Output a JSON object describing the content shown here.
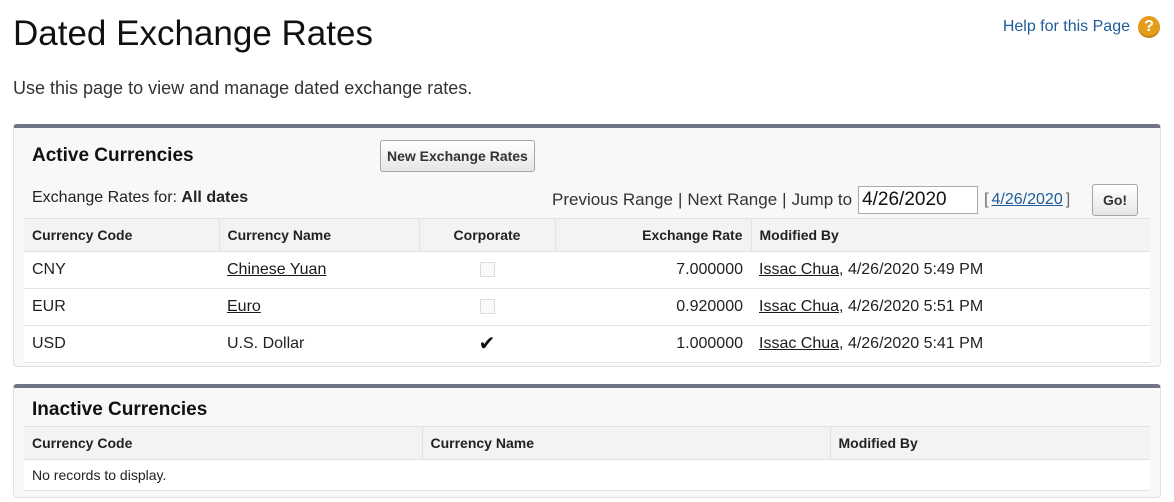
{
  "page": {
    "title": "Dated Exchange Rates",
    "description": "Use this page to view and manage dated exchange rates.",
    "help_link": "Help for this Page",
    "help_icon": "?"
  },
  "active": {
    "title": "Active Currencies",
    "new_button": "New Exchange Rates",
    "rates_for_label": "Exchange Rates for:",
    "rates_for_value": "All dates",
    "previous_range": "Previous Range",
    "next_range": "Next Range",
    "separator": "|",
    "jump_to_label": "Jump to",
    "jump_to_value": "4/26/2020",
    "bracket_open": "[",
    "bracket_close": "]",
    "today_link": "4/26/2020",
    "go_button": "Go!",
    "columns": [
      "Currency Code",
      "Currency Name",
      "Corporate",
      "Exchange Rate",
      "Modified By"
    ],
    "rows": [
      {
        "code": "CNY",
        "name": "Chinese Yuan",
        "corporate": false,
        "rate": "7.000000",
        "modified_user": "Issac Chua",
        "modified_date": ", 4/26/2020 5:49 PM"
      },
      {
        "code": "EUR",
        "name": "Euro",
        "corporate": false,
        "rate": "0.920000",
        "modified_user": "Issac Chua",
        "modified_date": ", 4/26/2020 5:51 PM"
      },
      {
        "code": "USD",
        "name": "U.S. Dollar",
        "corporate": true,
        "rate": "1.000000",
        "modified_user": "Issac Chua",
        "modified_date": ", 4/26/2020 5:41 PM"
      }
    ]
  },
  "inactive": {
    "title": "Inactive Currencies",
    "columns": [
      "Currency Code",
      "Currency Name",
      "Modified By"
    ],
    "empty_text": "No records to display."
  },
  "icons": {
    "help": "help-icon",
    "checked": "checkmark-icon"
  },
  "colors": {
    "link": "#1f5c99",
    "help_icon": "#e59c1d",
    "panel_border": "#6f7486"
  }
}
